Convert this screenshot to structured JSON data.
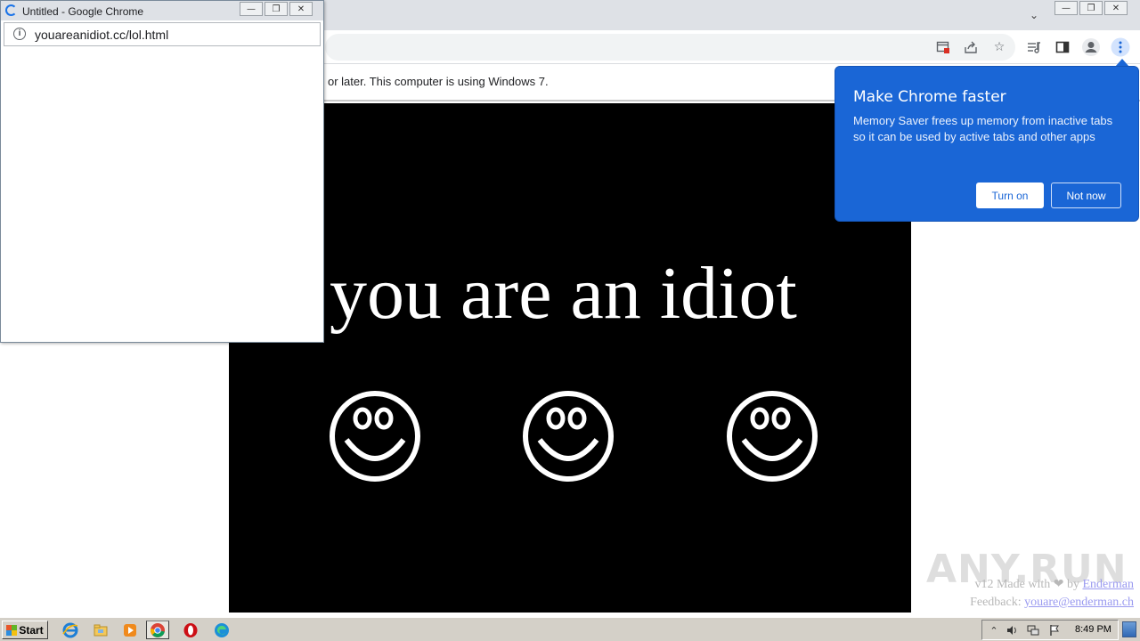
{
  "main_window": {
    "toolbar_icons": [
      "install-app-icon",
      "share-icon",
      "bookmark-star-icon",
      "reading-list-icon",
      "side-panel-icon",
      "profile-icon",
      "kebab-menu-icon"
    ],
    "infobar_text": "or later. This computer is using Windows 7."
  },
  "page": {
    "headline": "you are an idiot",
    "credits": {
      "made_with_prefix": "v12 Made with ❤ by ",
      "author_link": "Enderman",
      "feedback_prefix": "Feedback: ",
      "feedback_email": "youare@enderman.ch"
    },
    "watermark": "ANY.RUN",
    "colors": {
      "panel_bg": "#000000",
      "text": "#ffffff"
    }
  },
  "promo": {
    "title": "Make Chrome faster",
    "body": "Memory Saver frees up memory from inactive tabs so it can be used by active tabs and other apps",
    "turn_on_label": "Turn on",
    "not_now_label": "Not now",
    "accent": "#1a66d6"
  },
  "popup": {
    "title": "Untitled - Google Chrome",
    "url": "youareanidiot.cc/lol.html"
  },
  "taskbar": {
    "start_label": "Start",
    "apps": [
      "ie-icon",
      "explorer-icon",
      "media-player-icon",
      "chrome-icon",
      "opera-icon",
      "edge-icon"
    ],
    "clock": "8:49 PM"
  }
}
